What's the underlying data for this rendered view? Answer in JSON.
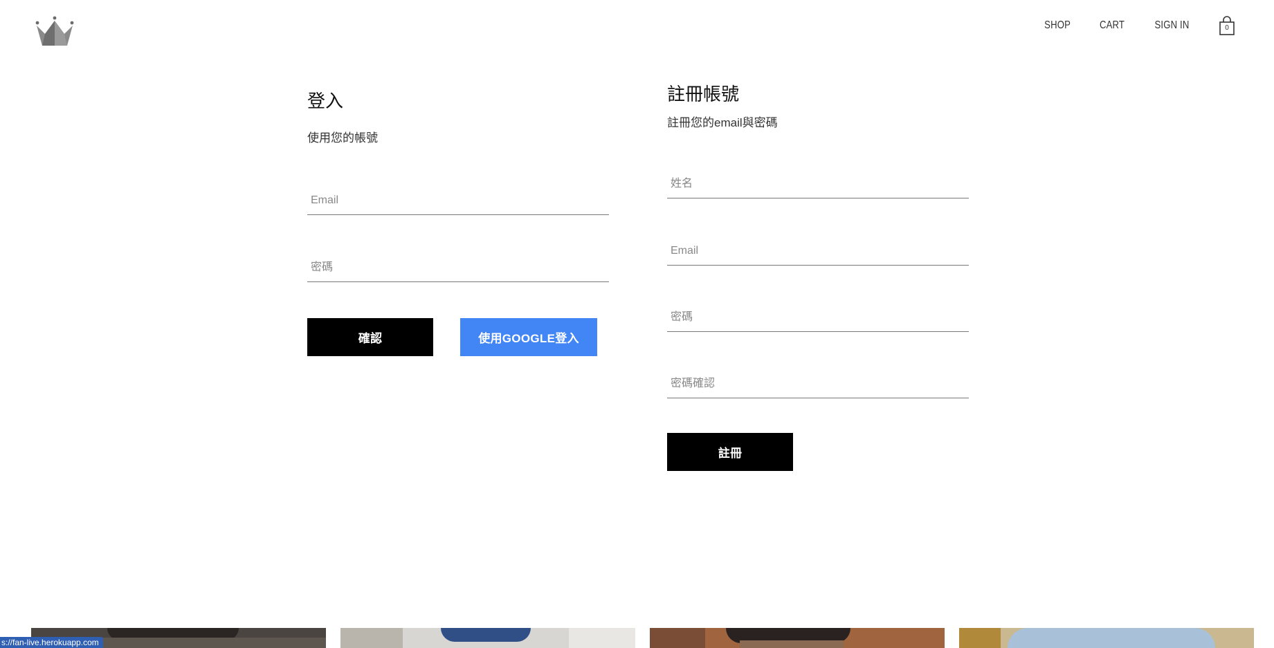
{
  "header": {
    "logo_icon": "crown-logo-icon",
    "nav": {
      "shop": "SHOP",
      "cart": "CART",
      "sign_in": "SIGN IN"
    },
    "cart_icon": "shopping-bag-icon",
    "cart_count": "0"
  },
  "login": {
    "title": "登入",
    "subtitle": "使用您的帳號",
    "email_placeholder": "Email",
    "password_placeholder": "密碼",
    "confirm_label": "確認",
    "google_label": "使用GOOGLE登入"
  },
  "register": {
    "title": "註冊帳號",
    "subtitle": "註冊您的email與密碼",
    "name_placeholder": "姓名",
    "email_placeholder": "Email",
    "password_placeholder": "密碼",
    "password_confirm_placeholder": "密碼確認",
    "submit_label": "註冊"
  },
  "status_bar": {
    "url": "s://fan-live.herokuapp.com"
  },
  "colors": {
    "primary_button": "#000000",
    "google_button": "#4285f4",
    "logo": "#707070",
    "status_bar": "#2f5fb3"
  }
}
